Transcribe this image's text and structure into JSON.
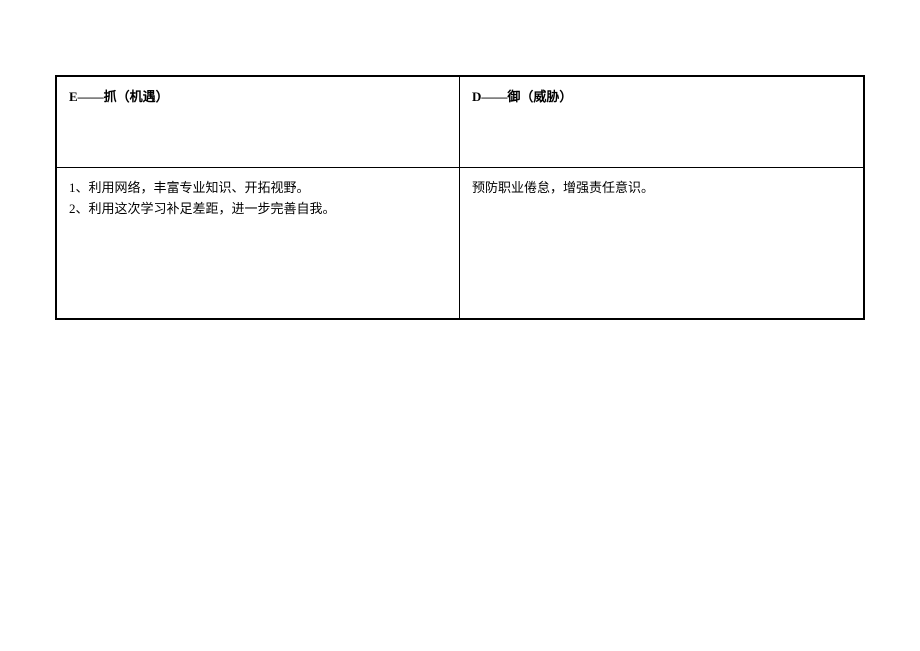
{
  "table": {
    "header": {
      "left": "E——抓（机遇）",
      "right": "D——御（威胁）"
    },
    "content": {
      "left_line1": "1、利用网络，丰富专业知识、开拓视野。",
      "left_line2": "2、利用这次学习补足差距，进一步完善自我。",
      "right": "预防职业倦怠，增强责任意识。"
    }
  }
}
